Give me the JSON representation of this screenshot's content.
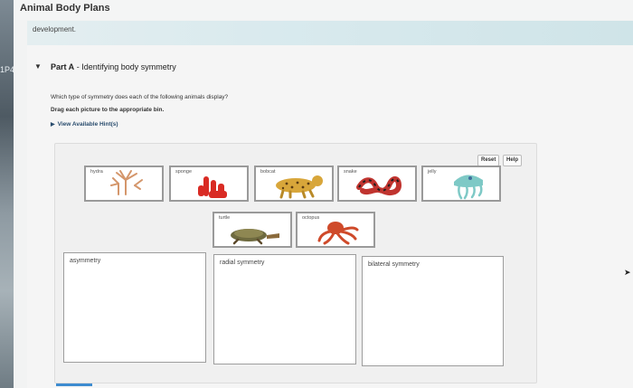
{
  "app": {
    "title": "Animal Body Plans",
    "left_mark": "1P4"
  },
  "breadcrumb": {
    "text": "development."
  },
  "part": {
    "label": "Part A",
    "title": "Identifying body symmetry"
  },
  "question": {
    "text": "Which type of symmetry does each of the following animals display?"
  },
  "instruction": {
    "text": "Drag each picture to the appropriate bin."
  },
  "hint": {
    "label": "View Available Hint(s)"
  },
  "toolbar": {
    "reset_label": "Reset",
    "help_label": "Help"
  },
  "animals": [
    {
      "id": "hydra",
      "label": "hydra",
      "icon": "hydra-icon",
      "color": "#d4966b"
    },
    {
      "id": "sponge",
      "label": "sponge",
      "icon": "sponge-icon",
      "color": "#d92b24"
    },
    {
      "id": "bobcat",
      "label": "bobcat",
      "icon": "bobcat-icon",
      "color": "#d8a63a"
    },
    {
      "id": "snake",
      "label": "snake",
      "icon": "snake-icon",
      "color": "#c0342f"
    },
    {
      "id": "jelly",
      "label": "jelly",
      "icon": "jelly-icon",
      "color": "#7ec9c6"
    },
    {
      "id": "turtle",
      "label": "turtle",
      "icon": "turtle-icon",
      "color": "#6e6a3f"
    },
    {
      "id": "octopus",
      "label": "octopus",
      "icon": "octopus-icon",
      "color": "#cf4a2a"
    }
  ],
  "bins": [
    {
      "id": "asymmetry",
      "label": "asymmetry"
    },
    {
      "id": "radial",
      "label": "radial symmetry"
    },
    {
      "id": "bilateral",
      "label": "bilateral symmetry"
    }
  ]
}
